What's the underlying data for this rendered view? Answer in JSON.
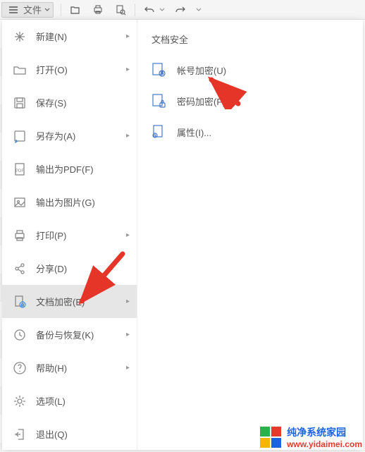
{
  "toolbar": {
    "file_label": "文件"
  },
  "menu": {
    "items": [
      {
        "label": "新建(N)",
        "has_sub": true
      },
      {
        "label": "打开(O)",
        "has_sub": true
      },
      {
        "label": "保存(S)",
        "has_sub": false
      },
      {
        "label": "另存为(A)",
        "has_sub": true
      },
      {
        "label": "输出为PDF(F)",
        "has_sub": false
      },
      {
        "label": "输出为图片(G)",
        "has_sub": false
      },
      {
        "label": "打印(P)",
        "has_sub": true
      },
      {
        "label": "分享(D)",
        "has_sub": false
      },
      {
        "label": "文档加密(E)",
        "has_sub": true
      },
      {
        "label": "备份与恢复(K)",
        "has_sub": true
      },
      {
        "label": "帮助(H)",
        "has_sub": true
      },
      {
        "label": "选项(L)",
        "has_sub": false
      },
      {
        "label": "退出(Q)",
        "has_sub": false
      }
    ]
  },
  "sub": {
    "header": "文档安全",
    "items": [
      {
        "label": "帐号加密(U)"
      },
      {
        "label": "密码加密(P)"
      },
      {
        "label": "属性(I)..."
      }
    ]
  },
  "watermark": {
    "title": "纯净系统家园",
    "url": "www.yidaimei.com"
  }
}
